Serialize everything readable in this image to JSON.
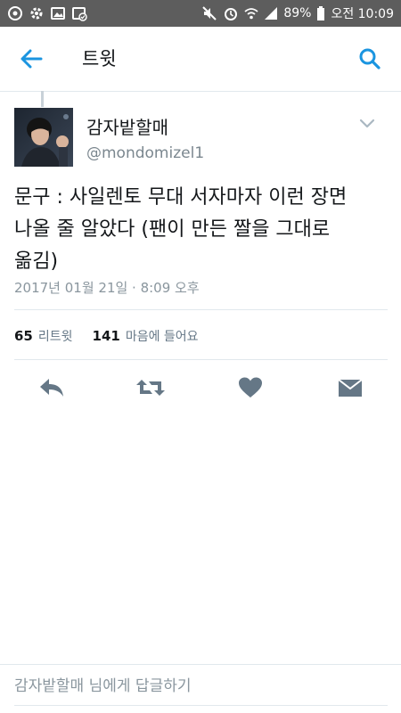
{
  "status_bar": {
    "battery_percent": "89%",
    "time": "오전 10:09",
    "left_icons": [
      "sync-icon",
      "gear-icon",
      "image-icon",
      "photo-check-icon"
    ],
    "right_icons": [
      "mute-icon",
      "alarm-icon",
      "wifi-icon",
      "signal-icon",
      "battery-icon"
    ]
  },
  "header": {
    "title": "트윗",
    "back_icon": "back-arrow-icon",
    "search_icon": "search-icon"
  },
  "tweet": {
    "author_name": "감자밭할매",
    "author_handle": "@mondomizel1",
    "text": "문구 : 사일렌토 무대 서자마자 이런 장면\n나올 줄 알았다 (팬이 만든 짤을 그대로\n옮김)",
    "timestamp": "2017년 01월 21일 · 8:09 오후",
    "stats": {
      "retweets_count": "65",
      "retweets_label": "리트윗",
      "likes_count": "141",
      "likes_label": "마음에 들어요"
    },
    "actions": [
      "reply-icon",
      "retweet-icon",
      "heart-icon",
      "message-icon"
    ]
  },
  "reply_bar": {
    "placeholder": "감자밭할매 님에게 답글하기"
  },
  "colors": {
    "accent": "#1b95e0",
    "status_bar": "#5d5d5d",
    "action_icon": "#657786",
    "secondary_text": "#8a969e"
  }
}
